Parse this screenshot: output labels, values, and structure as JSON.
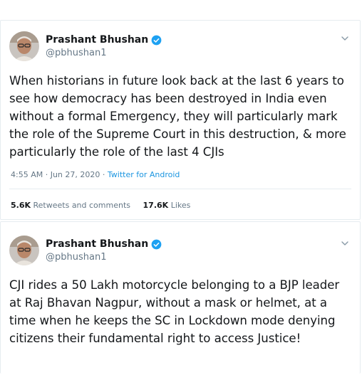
{
  "tweets": [
    {
      "author": {
        "name": "Prashant Bhushan",
        "handle": "@pbhushan1"
      },
      "text": "When historians in future look back at the last 6 years to see how democracy has been destroyed in India even without a formal Emergency, they will particularly mark the role of the Supreme Court in this destruction, & more particularly the role of the last 4 CJIs",
      "time": "4:55 AM · Jun 27, 2020 · ",
      "source": "Twitter for Android",
      "stats": {
        "retweets_count": "5.6K",
        "retweets_label": "Retweets and comments",
        "likes_count": "17.6K",
        "likes_label": "Likes"
      }
    },
    {
      "author": {
        "name": "Prashant Bhushan",
        "handle": "@pbhushan1"
      },
      "text": "CJI rides a 50 Lakh motorcycle belonging to a BJP leader at Raj Bhavan Nagpur, without a mask or helmet, at a time when he keeps the SC in Lockdown mode denying citizens their fundamental right to access Justice!"
    }
  ],
  "icons": {
    "verified": "verified-badge-icon",
    "caret": "chevron-down-icon"
  },
  "colors": {
    "text": "#14171a",
    "secondary": "#657786",
    "link": "#1b95e0",
    "verified": "#1da1f2",
    "border": "#e6ecf0"
  }
}
